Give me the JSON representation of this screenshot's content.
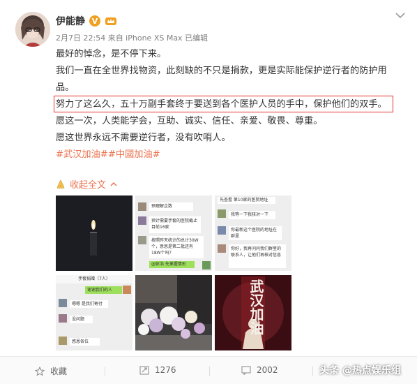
{
  "post": {
    "author": "伊能静",
    "meta": "2月7日 22:54 来自 iPhone XS Max  已编辑",
    "paragraphs": [
      "最好的悼念，是不停下来。",
      "我们一直在全世界找物资，此刻缺的不只是捐款，更是实际能保护逆行者的防护用品。",
      "努力了这么久，五十万副手套终于要送到各个医护人员的手中，保护他们的双手。",
      "愿这一次，人类能学会，互助、诚实、信任、亲爱、敬畏、尊重。",
      "愿这世界永远不需要逆行者，没有吹哨人。"
    ],
    "tags": "#武汉加油##中國加油#",
    "collapse_label": "收起全文"
  },
  "thumbs": {
    "chat1": [
      "预理解企数",
      "预计需要手套的医院截止目前16家",
      "按照昨天统计的总计30W个，意思是第二批还有18W个吗？",
      "@彭浩 先掌握情形"
    ],
    "chat2": [
      "先查看 第10家的医院地址",
      "我等一下我核对一下",
      "你最新这个医院的地址在群里",
      "你好，我再问问我们群里的联系人，让他们再核对信息"
    ],
    "chat3": [
      "手套捐赠（7人）",
      "谢谢我们的人",
      "嗯嗯 是我们寄付",
      "没问题",
      "感恩各位"
    ],
    "poster": "武汉加油"
  },
  "footer": {
    "favorite_label": "收藏",
    "repost_count": "1276",
    "comment_count": "2002"
  },
  "watermark": "头条 @热点娱乐组",
  "colors": {
    "accent": "#eb7350",
    "highlight_border": "#e0322c",
    "vip": "#f0a020"
  }
}
